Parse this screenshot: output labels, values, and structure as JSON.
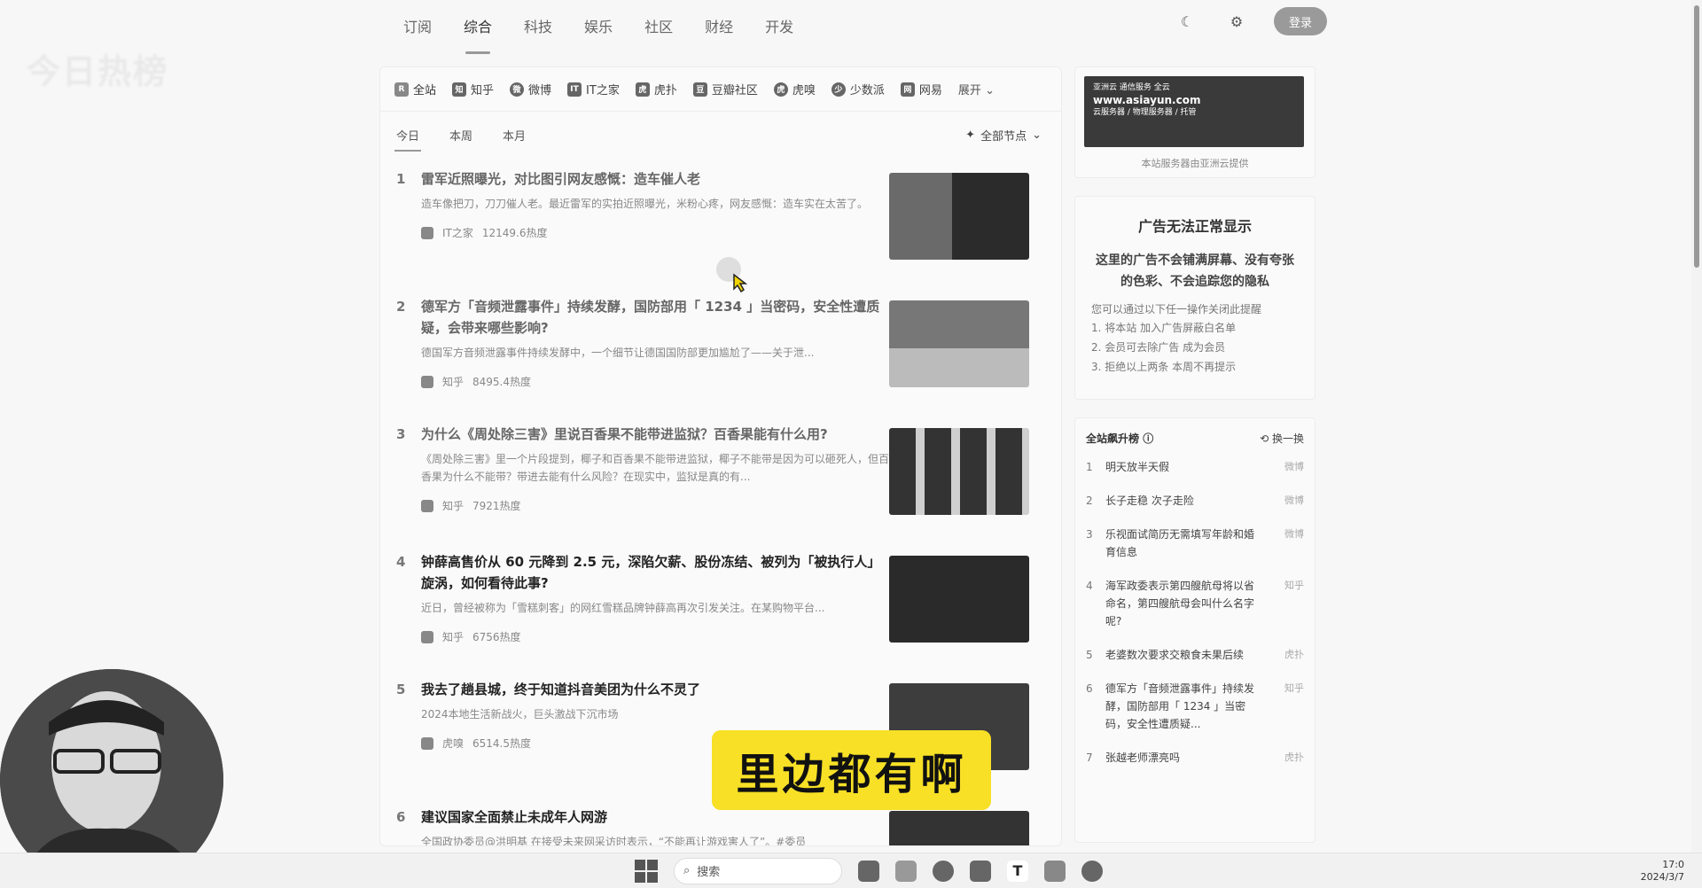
{
  "logo_text": "今日热榜",
  "top_nav": [
    "订阅",
    "综合",
    "科技",
    "娱乐",
    "社区",
    "财经",
    "开发"
  ],
  "top_nav_active": 1,
  "topright": {
    "login": "登录"
  },
  "sources": [
    {
      "icon": "R",
      "label": "全站",
      "active": true
    },
    {
      "icon": "知",
      "label": "知乎"
    },
    {
      "icon": "微",
      "label": "微博"
    },
    {
      "icon": "IT",
      "label": "IT之家"
    },
    {
      "icon": "虎",
      "label": "虎扑"
    },
    {
      "icon": "豆",
      "label": "豆瓣社区"
    },
    {
      "icon": "虎",
      "label": "虎嗅"
    },
    {
      "icon": "少",
      "label": "少数派"
    },
    {
      "icon": "网",
      "label": "网易"
    }
  ],
  "sources_expand": "展开",
  "time_tabs": [
    "今日",
    "本周",
    "本月"
  ],
  "all_nodes": "全部节点",
  "news": [
    {
      "rank": "1",
      "title": "雷军近照曝光，对比图引网友感慨：造车催人老",
      "desc": "造车像把刀，刀刀催人老。最近雷军的实拍近照曝光，米粉心疼，网友感慨：造车实在太苦了。",
      "source": "IT之家",
      "heat": "12149.6热度",
      "dark": false
    },
    {
      "rank": "2",
      "title": "德军方「音频泄露事件」持续发酵，国防部用「 1234 」当密码，安全性遭质疑，会带来哪些影响?",
      "desc": "德国军方音频泄露事件持续发酵中，一个细节让德国国防部更加尴尬了——关于泄...",
      "source": "知乎",
      "heat": "8495.4热度",
      "dark": false
    },
    {
      "rank": "3",
      "title": "为什么《周处除三害》里说百香果不能带进监狱？百香果能有什么用?",
      "desc": "《周处除三害》里一个片段提到，椰子和百香果不能带进监狱，椰子不能带是因为可以砸死人，但百香果为什么不能带？带进去能有什么风险？在现实中，监狱是真的有...",
      "source": "知乎",
      "heat": "7921热度",
      "dark": false
    },
    {
      "rank": "4",
      "title": "钟薛高售价从 60 元降到 2.5 元，深陷欠薪、股份冻结、被列为「被执行人」旋涡，如何看待此事?",
      "desc": "近日，曾经被称为「雪糕刺客」的网红雪糕品牌钟薛高再次引发关注。在某购物平台...",
      "source": "知乎",
      "heat": "6756热度",
      "dark": true
    },
    {
      "rank": "5",
      "title": "我去了趟县城，终于知道抖音美团为什么不灵了",
      "desc": "2024本地生活新战火，巨头激战下沉市场",
      "source": "虎嗅",
      "heat": "6514.5热度",
      "dark": true
    },
    {
      "rank": "6",
      "title": "建议国家全面禁止未成年人网游",
      "desc": "全国政协委员@洪明基 在接受未来网采访时表示，“不能再让游戏害人了”。#委员",
      "source": "",
      "heat": "",
      "dark": true
    }
  ],
  "ad": {
    "line1": "亚洲云 通信服务 全云",
    "url": "www.asiayun.com",
    "line2": "云服务器 / 物理服务器 / 托管",
    "foot": "本站服务器由亚洲云提供"
  },
  "noad": {
    "title": "广告无法正常显示",
    "lead": "这里的广告不会铺满屏幕、没有夸张的色彩、不会追踪您的隐私",
    "sub": "您可以通过以下任一操作关闭此提醒",
    "items": [
      "1. 将本站 加入广告屏蔽白名单",
      "2. 会员可去除广告 成为会员",
      "3. 拒绝以上两条 本周不再提示"
    ]
  },
  "rising": {
    "title": "全站飙升榜",
    "refresh": "换一换",
    "items": [
      {
        "n": "1",
        "text": "明天放半天假",
        "src": "微博"
      },
      {
        "n": "2",
        "text": "长子走稳 次子走险",
        "src": "微博"
      },
      {
        "n": "3",
        "text": "乐视面试简历无需填写年龄和婚育信息",
        "src": "微博"
      },
      {
        "n": "4",
        "text": "海军政委表示第四艘航母将以省命名，第四艘航母会叫什么名字呢?",
        "src": "知乎"
      },
      {
        "n": "5",
        "text": "老婆数次要求交粮食未果后续",
        "src": "虎扑"
      },
      {
        "n": "6",
        "text": "德军方「音频泄露事件」持续发酵，国防部用「 1234 」当密码，安全性遭质疑...",
        "src": "知乎"
      },
      {
        "n": "7",
        "text": "张越老师漂亮吗",
        "src": "虎扑"
      }
    ]
  },
  "taskbar": {
    "search": "搜索",
    "time": "17:0",
    "date": "2024/3/7"
  },
  "caption": "里边都有啊"
}
